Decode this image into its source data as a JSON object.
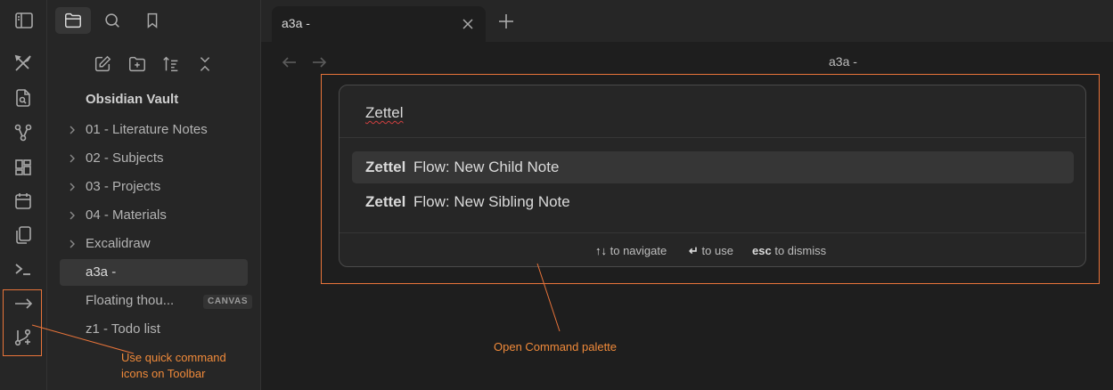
{
  "ribbon": {
    "icons": [
      "sidebar-toggle-icon",
      "excalidraw-icon",
      "file-search-icon",
      "graph-icon",
      "dashboard-icon",
      "calendar-icon",
      "copy-icon",
      "terminal-icon",
      "arrow-right-icon",
      "branch-plus-icon"
    ]
  },
  "explorer": {
    "top_buttons": [
      "files-icon",
      "search-icon",
      "bookmark-icon"
    ],
    "nav_buttons": [
      "new-note-icon",
      "new-folder-icon",
      "sort-icon",
      "collapse-icon"
    ],
    "vault_name": "Obsidian Vault",
    "items": [
      {
        "label": "01 - Literature Notes",
        "folder": true
      },
      {
        "label": "02 - Subjects",
        "folder": true
      },
      {
        "label": "03 - Projects",
        "folder": true
      },
      {
        "label": "04 - Materials",
        "folder": true
      },
      {
        "label": "Excalidraw",
        "folder": true
      },
      {
        "label": "a3a -",
        "folder": false,
        "selected": true
      },
      {
        "label": "Floating thou...",
        "folder": false,
        "badge": "CANVAS"
      },
      {
        "label": "z1 - Todo list",
        "folder": false
      }
    ]
  },
  "tabs": {
    "active_title": "a3a -",
    "close_icon": "close-icon",
    "new_tab_icon": "plus-icon"
  },
  "view": {
    "title": "a3a -",
    "back_icon": "arrow-left-icon",
    "forward_icon": "arrow-right-icon"
  },
  "palette": {
    "query": "Zettel",
    "suggestions": [
      {
        "match": "Zettel",
        "rest": "Flow: New Child Note",
        "selected": true
      },
      {
        "match": "Zettel",
        "rest": "Flow: New Sibling Note",
        "selected": false
      }
    ],
    "instructions": [
      {
        "key": "↑↓",
        "text": "to navigate"
      },
      {
        "key": "↵",
        "text": "to use"
      },
      {
        "key": "esc",
        "text": "to dismiss"
      }
    ]
  },
  "annotations": {
    "toolbar_note_line1": "Use quick command",
    "toolbar_note_line2": "icons on Toolbar",
    "palette_note": "Open Command palette",
    "accent": "#e8743a"
  }
}
